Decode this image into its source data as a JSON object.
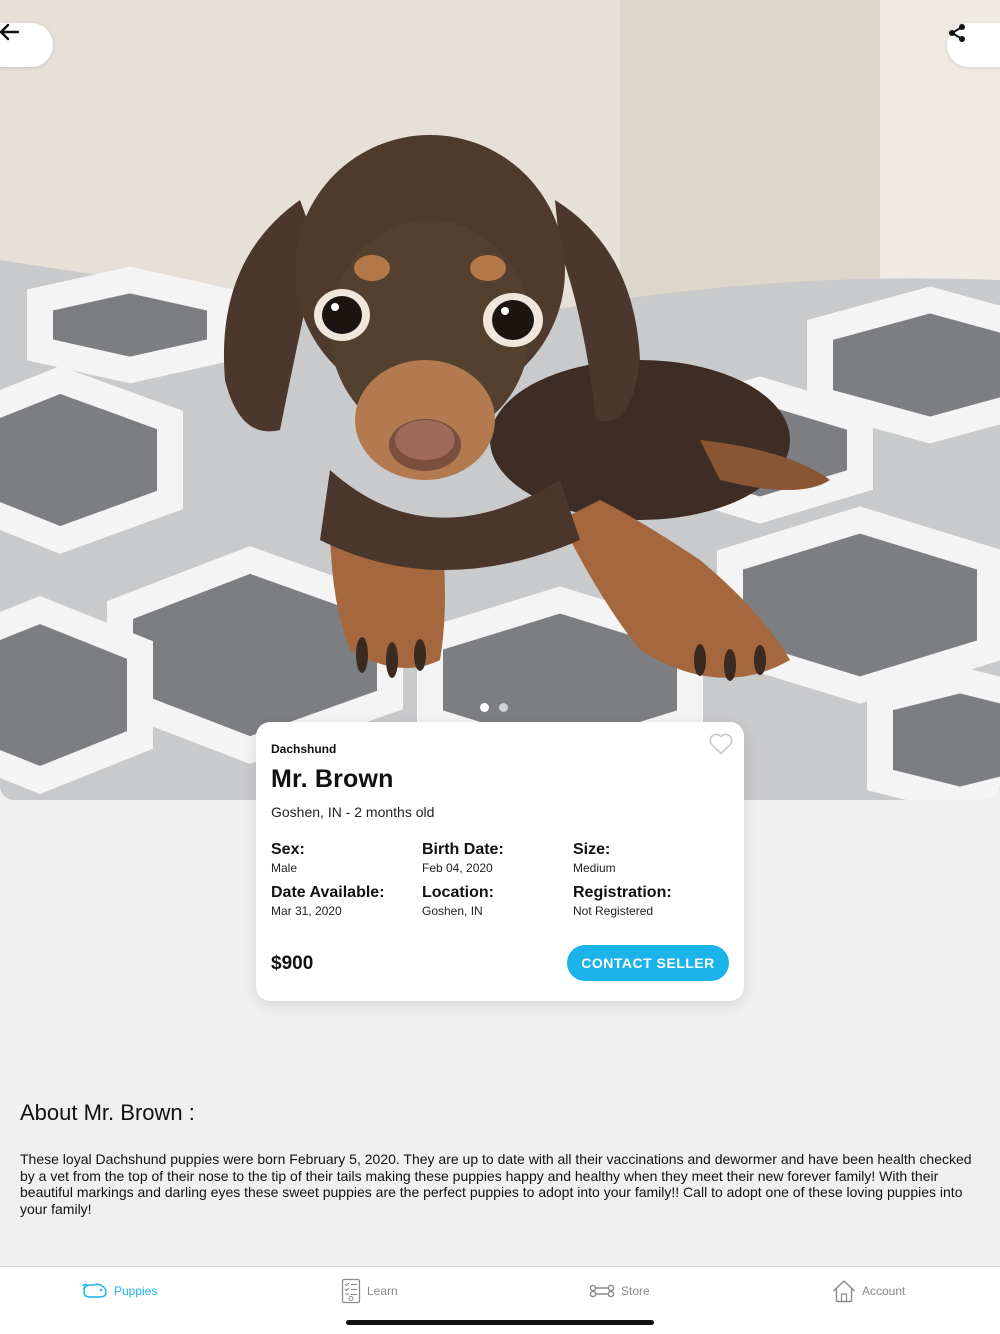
{
  "header": {
    "back_icon": "arrow-left-icon",
    "share_icon": "share-icon"
  },
  "gallery": {
    "image": "dachshund-puppy-photo",
    "total_images": 2,
    "current_index": 1
  },
  "listing": {
    "breed": "Dachshund",
    "name": "Mr. Brown",
    "location_age": "Goshen, IN - 2 months old",
    "favorite_icon": "heart-outline-icon",
    "specs": [
      {
        "label": "Sex:",
        "value": "Male"
      },
      {
        "label": "Birth Date:",
        "value": "Feb 04, 2020"
      },
      {
        "label": "Size:",
        "value": "Medium"
      },
      {
        "label": "Date Available:",
        "value": "Mar 31, 2020"
      },
      {
        "label": "Location:",
        "value": "Goshen, IN"
      },
      {
        "label": "Registration:",
        "value": "Not Registered"
      }
    ],
    "price": "$900",
    "contact_label": "CONTACT SELLER"
  },
  "about": {
    "title": "About Mr. Brown :",
    "text": "These loyal Dachshund puppies were born February 5, 2020. They are up to date with all their vaccinations and dewormer and have been health checked by a vet from the top of their nose to the tip of their tails making these puppies happy and healthy when they meet their new forever family! With their beautiful markings and darling eyes these sweet puppies are the perfect puppies to adopt into your family!! Call to adopt one of these loving puppies into your family!"
  },
  "tabbar": {
    "items": [
      {
        "label": "Puppies",
        "icon": "puppy-icon",
        "active": true
      },
      {
        "label": "Learn",
        "icon": "checklist-icon",
        "active": false
      },
      {
        "label": "Store",
        "icon": "bone-icon",
        "active": false
      },
      {
        "label": "Account",
        "icon": "house-icon",
        "active": false
      }
    ]
  },
  "colors": {
    "accent": "#1bb4e8",
    "background": "#f0f0f0",
    "inactive_tab": "#8a8a8a"
  }
}
